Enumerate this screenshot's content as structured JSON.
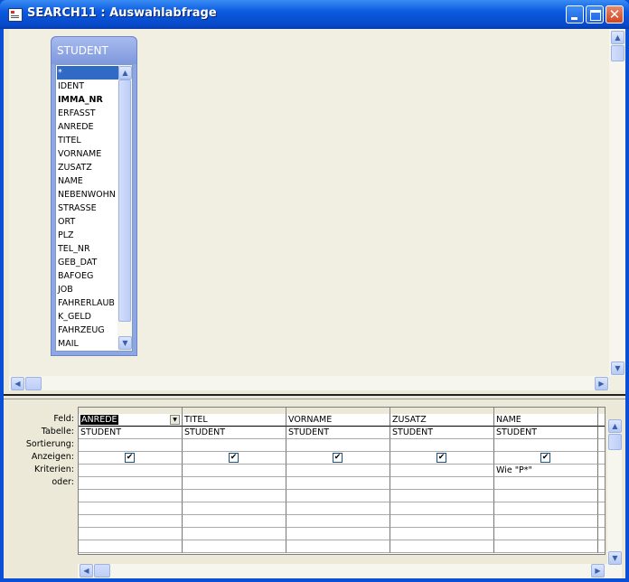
{
  "window": {
    "title": "SEARCH11 : Auswahlabfrage",
    "minimize_glyph": "",
    "close_glyph": "✕"
  },
  "table_box": {
    "title": "STUDENT",
    "fields": [
      "*",
      "IDENT",
      "IMMA_NR",
      "ERFASST",
      "ANREDE",
      "TITEL",
      "VORNAME",
      "ZUSATZ",
      "NAME",
      "NEBENWOHN",
      "STRASSE",
      "ORT",
      "PLZ",
      "TEL_NR",
      "GEB_DAT",
      "BAFOEG",
      "JOB",
      "FAHRERLAUB",
      "K_GELD",
      "FAHRZEUG",
      "MAIL"
    ],
    "selected_field": "*",
    "key_field": "IMMA_NR"
  },
  "grid": {
    "row_labels": {
      "feld": "Feld:",
      "tabelle": "Tabelle:",
      "sortierung": "Sortierung:",
      "anzeigen": "Anzeigen:",
      "kriterien": "Kriterien:",
      "oder": "oder:"
    },
    "columns": [
      {
        "feld": "ANREDE",
        "tabelle": "STUDENT",
        "sortierung": "",
        "anzeigen": true,
        "kriterien": "",
        "oder": ""
      },
      {
        "feld": "TITEL",
        "tabelle": "STUDENT",
        "sortierung": "",
        "anzeigen": true,
        "kriterien": "",
        "oder": ""
      },
      {
        "feld": "VORNAME",
        "tabelle": "STUDENT",
        "sortierung": "",
        "anzeigen": true,
        "kriterien": "",
        "oder": ""
      },
      {
        "feld": "ZUSATZ",
        "tabelle": "STUDENT",
        "sortierung": "",
        "anzeigen": true,
        "kriterien": "",
        "oder": ""
      },
      {
        "feld": "NAME",
        "tabelle": "STUDENT",
        "sortierung": "",
        "anzeigen": true,
        "kriterien": "Wie \"P*\"",
        "oder": ""
      }
    ],
    "checkbox_glyph": "✔",
    "dropdown_glyph": "▼"
  },
  "scroll": {
    "up_glyph": "▲",
    "down_glyph": "▼",
    "left_glyph": "◀",
    "right_glyph": "▶",
    "grip_glyph": "≡"
  },
  "colors": {
    "titlebar": "#0a5ae0",
    "selection": "#316ac5",
    "table_header": "#8ea6e4"
  }
}
